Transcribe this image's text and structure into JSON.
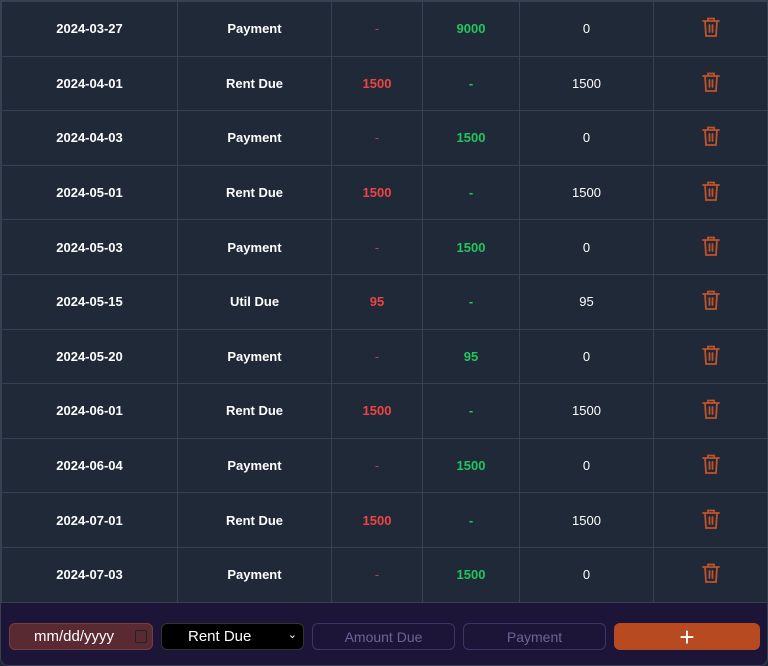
{
  "colors": {
    "debit": "#ef4444",
    "credit": "#22c55e",
    "delete": "#c2522a",
    "add_button": "#b84a22"
  },
  "rows": [
    {
      "date": "2024-03-27",
      "type": "Payment",
      "debit": "-",
      "credit": "9000",
      "balance": "0"
    },
    {
      "date": "2024-04-01",
      "type": "Rent Due",
      "debit": "1500",
      "credit": "-",
      "balance": "1500"
    },
    {
      "date": "2024-04-03",
      "type": "Payment",
      "debit": "-",
      "credit": "1500",
      "balance": "0"
    },
    {
      "date": "2024-05-01",
      "type": "Rent Due",
      "debit": "1500",
      "credit": "-",
      "balance": "1500"
    },
    {
      "date": "2024-05-03",
      "type": "Payment",
      "debit": "-",
      "credit": "1500",
      "balance": "0"
    },
    {
      "date": "2024-05-15",
      "type": "Util Due",
      "debit": "95",
      "credit": "-",
      "balance": "95"
    },
    {
      "date": "2024-05-20",
      "type": "Payment",
      "debit": "-",
      "credit": "95",
      "balance": "0"
    },
    {
      "date": "2024-06-01",
      "type": "Rent Due",
      "debit": "1500",
      "credit": "-",
      "balance": "1500"
    },
    {
      "date": "2024-06-04",
      "type": "Payment",
      "debit": "-",
      "credit": "1500",
      "balance": "0"
    },
    {
      "date": "2024-07-01",
      "type": "Rent Due",
      "debit": "1500",
      "credit": "-",
      "balance": "1500"
    },
    {
      "date": "2024-07-03",
      "type": "Payment",
      "debit": "-",
      "credit": "1500",
      "balance": "0"
    }
  ],
  "form": {
    "date_placeholder": "mm/dd/yyyy",
    "type_selected": "Rent Due",
    "amount_placeholder": "Amount Due",
    "payment_placeholder": "Payment",
    "add_label": "+"
  }
}
